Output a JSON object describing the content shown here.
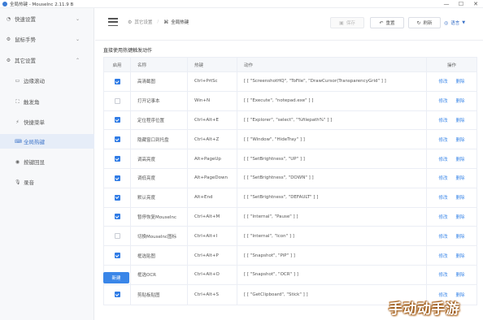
{
  "window": {
    "title": "全局热键 - MouseInc 2.11.9 B",
    "minimize": "—",
    "maximize": "☐",
    "close": "✕"
  },
  "sidebar": {
    "items": [
      {
        "label": "快速设置",
        "icon": "bell-icon",
        "glyph": "◔",
        "chevron": "⌄"
      },
      {
        "label": "鼠标手势",
        "icon": "gear-icon",
        "glyph": "⚙",
        "chevron": "⌄"
      },
      {
        "label": "其它设置",
        "icon": "gear-icon",
        "glyph": "⚙",
        "chevron": "⌃"
      },
      {
        "label": "边缘滚动",
        "icon": "monitor-icon",
        "glyph": "▭"
      },
      {
        "label": "触发角",
        "icon": "corners-icon",
        "glyph": "⛶"
      },
      {
        "label": "快捷菜单",
        "icon": "lightning-icon",
        "glyph": "⚡"
      },
      {
        "label": "全局热键",
        "icon": "keyboard-icon",
        "glyph": "⌨"
      },
      {
        "label": "按键回显",
        "icon": "record-icon",
        "glyph": "◉"
      },
      {
        "label": "录音",
        "icon": "microphone-icon",
        "glyph": "🎙"
      }
    ]
  },
  "header": {
    "breadcrumb": [
      "其它设置",
      "全局热键"
    ],
    "save_label": "保存",
    "reset_label": "重置",
    "refresh_label": "刷新",
    "language_label": "语言"
  },
  "main": {
    "section_title": "直接使用热键触发动作",
    "columns": [
      "启用",
      "名称",
      "热键",
      "动作",
      "操作"
    ],
    "edit_label": "修改",
    "delete_label": "删除",
    "new_label": "新建",
    "rows": [
      {
        "enabled": true,
        "name": "高清截图",
        "hotkey": "Ctrl+PrtSc",
        "action": "[ [ \"ScreenshotHQ\", \"ToFile\", \"DrawCursor(TransparencyGrid\" ] ]"
      },
      {
        "enabled": false,
        "name": "打开记事本",
        "hotkey": "Win+N",
        "action": "[ [ \"Execute\", \"notepad.exe\" ] ]"
      },
      {
        "enabled": true,
        "name": "定位程序位置",
        "hotkey": "Ctrl+Alt+E",
        "action": "[ [ \"Explorer\", \"select\", \"%filepath%\" ] ]"
      },
      {
        "enabled": true,
        "name": "隐藏窗口到托盘",
        "hotkey": "Ctrl+Alt+Z",
        "action": "[ [ \"Window\", \"HideTray\" ] ]"
      },
      {
        "enabled": true,
        "name": "调高亮度",
        "hotkey": "Alt+PageUp",
        "action": "[ [ \"SetBrightness\", \"UP\" ] ]"
      },
      {
        "enabled": true,
        "name": "调低亮度",
        "hotkey": "Alt+PageDown",
        "action": "[ [ \"SetBrightness\", \"DOWN\" ] ]"
      },
      {
        "enabled": true,
        "name": "默认亮度",
        "hotkey": "Alt+End",
        "action": "[ [ \"SetBrightness\", \"DEFAULT\" ] ]"
      },
      {
        "enabled": true,
        "name": "暂停恢复MouseInc",
        "hotkey": "Ctrl+Alt+M",
        "action": "[ [ \"Internal\", \"Pause\" ] ]"
      },
      {
        "enabled": false,
        "name": "切换MouseInc图标",
        "hotkey": "Ctrl+Alt+I",
        "action": "[ [ \"Internal\", \"Icon\" ] ]"
      },
      {
        "enabled": true,
        "name": "框选贴图",
        "hotkey": "Ctrl+Alt+P",
        "action": "[ [ \"Snapshot\", \"PiP\" ] ]"
      },
      {
        "enabled": true,
        "name": "框选OCR",
        "hotkey": "Ctrl+Alt+O",
        "action": "[ [ \"Snapshot\", \"OCR\" ] ]"
      },
      {
        "enabled": true,
        "name": "剪贴板贴图",
        "hotkey": "Ctrl+Alt+S",
        "action": "[ [ \"GetClipboard\", \"Stick\" ] ]"
      }
    ]
  },
  "watermark": {
    "text": "手动动手游"
  }
}
